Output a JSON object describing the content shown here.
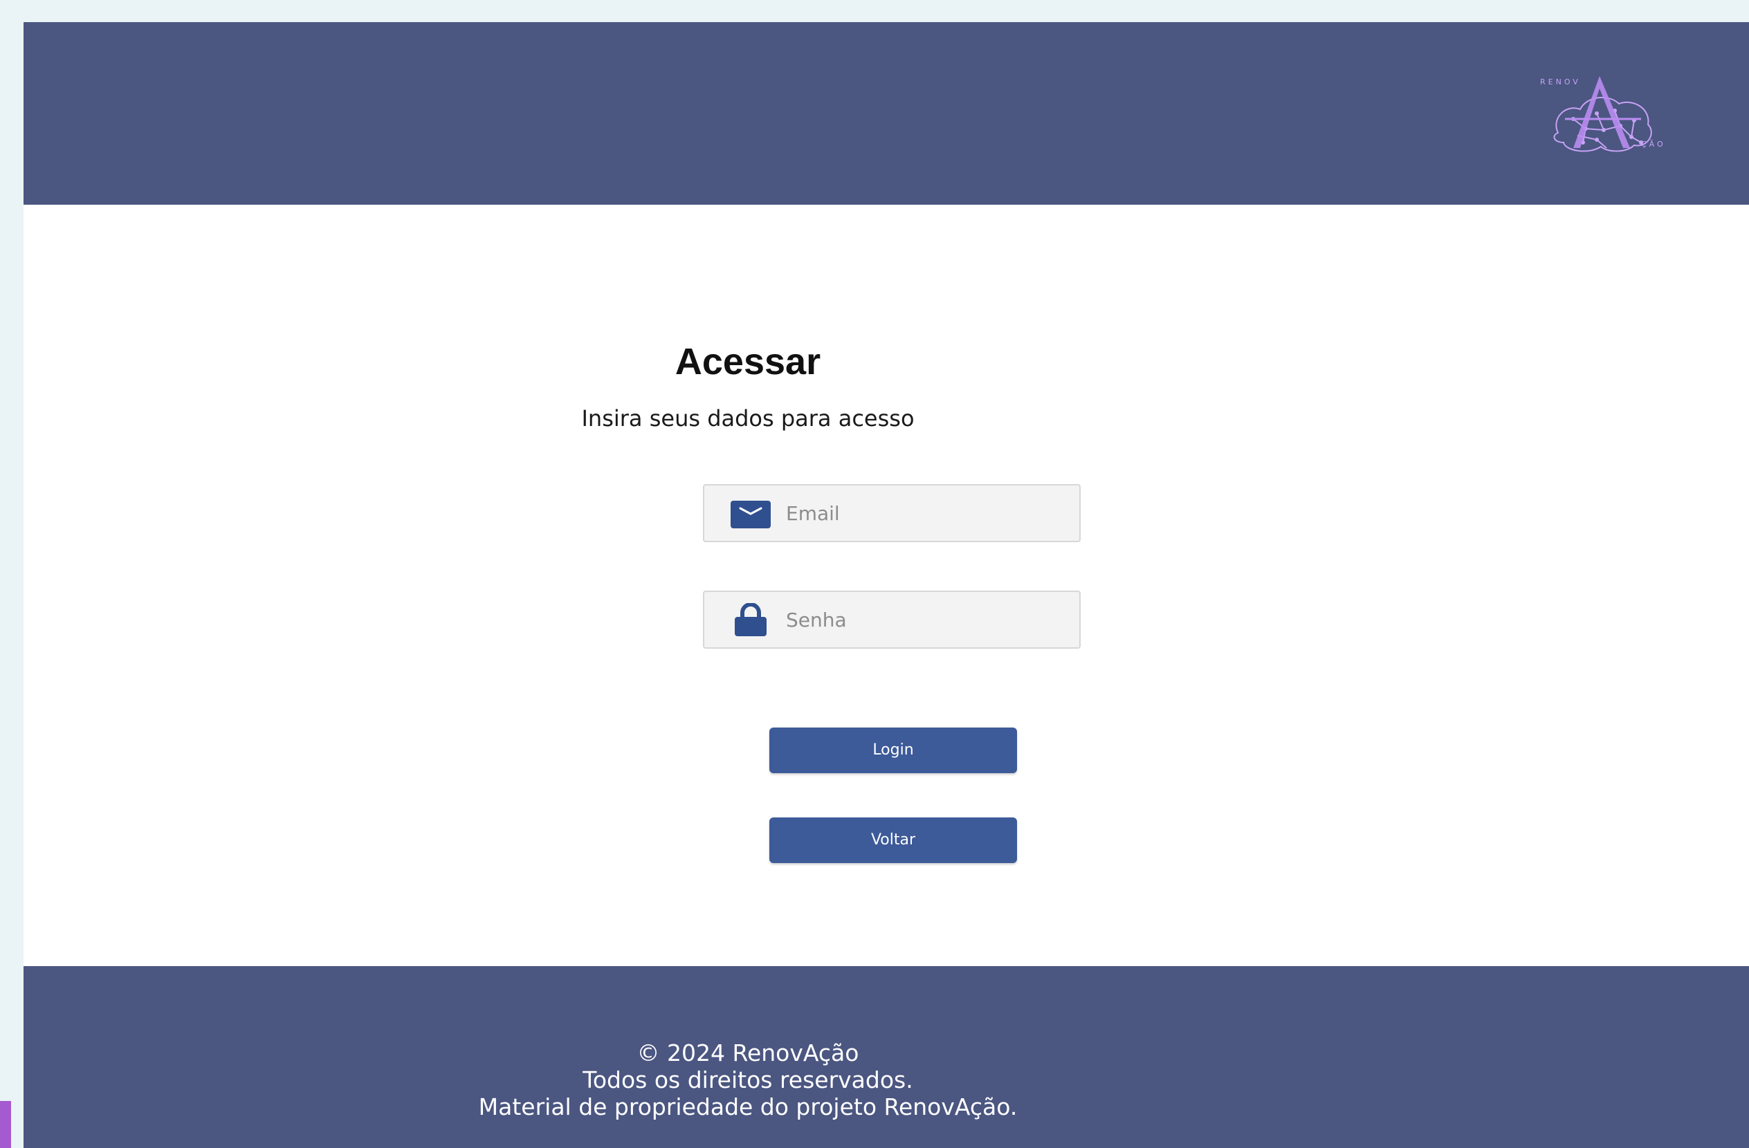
{
  "header": {
    "logo_icon": "renovacao-logo-icon",
    "logo_text_top": "RENOV",
    "logo_text_bottom": "ÇÃO"
  },
  "login": {
    "title": "Acessar",
    "subtitle": "Insira seus dados para acesso",
    "email_placeholder": "Email",
    "email_icon": "envelope-icon",
    "password_placeholder": "Senha",
    "password_icon": "lock-icon",
    "login_label": "Login",
    "back_label": "Voltar"
  },
  "footer": {
    "line1": "© 2024 RenovAção",
    "line2": "Todos os direitos reservados.",
    "line3": "Material de propriedade do projeto RenovAção."
  },
  "colors": {
    "header_bg": "#4b5681",
    "button_bg": "#3d5a99",
    "icon_color": "#2f4f8f",
    "logo_accent": "#b98cf0",
    "page_outer_bg": "#eaf4f6"
  }
}
